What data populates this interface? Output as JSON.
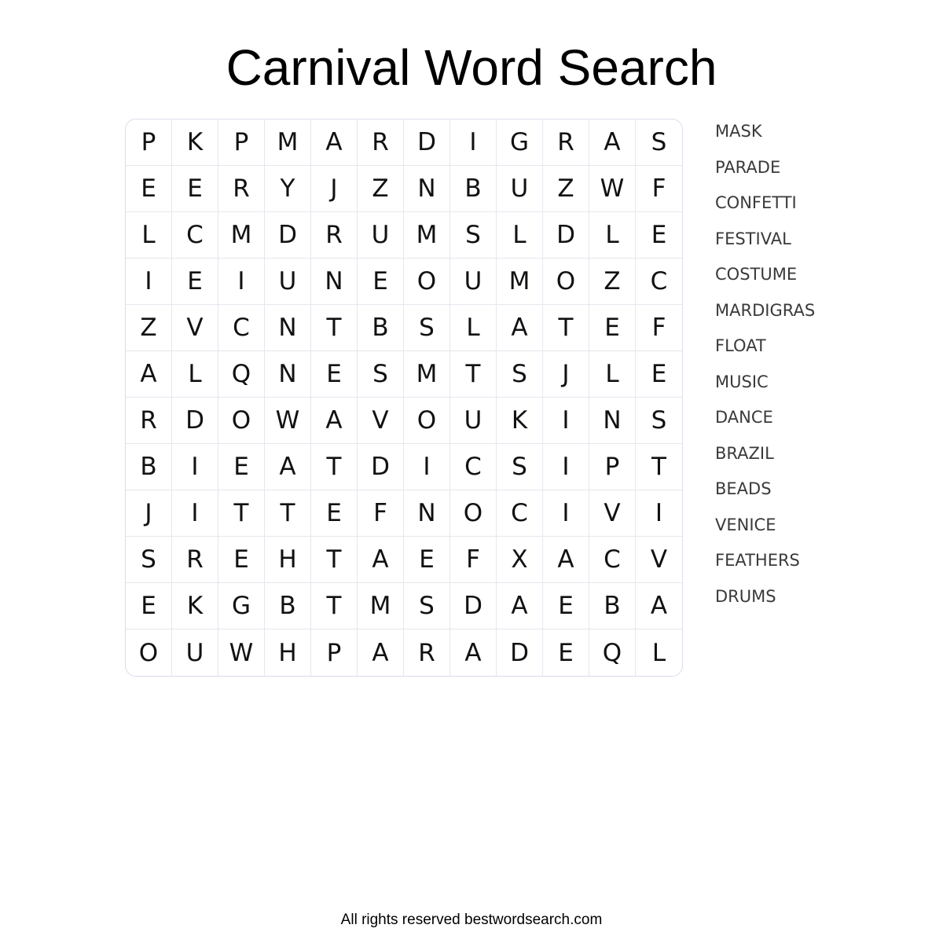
{
  "title": "Carnival Word Search",
  "grid": [
    [
      "P",
      "K",
      "P",
      "M",
      "A",
      "R",
      "D",
      "I",
      "G",
      "R",
      "A",
      "S"
    ],
    [
      "E",
      "E",
      "R",
      "Y",
      "J",
      "Z",
      "N",
      "B",
      "U",
      "Z",
      "W",
      "F"
    ],
    [
      "L",
      "C",
      "M",
      "D",
      "R",
      "U",
      "M",
      "S",
      "L",
      "D",
      "L",
      "E"
    ],
    [
      "I",
      "E",
      "I",
      "U",
      "N",
      "E",
      "O",
      "U",
      "M",
      "O",
      "Z",
      "C"
    ],
    [
      "Z",
      "V",
      "C",
      "N",
      "T",
      "B",
      "S",
      "L",
      "A",
      "T",
      "E",
      "F"
    ],
    [
      "A",
      "L",
      "Q",
      "N",
      "E",
      "S",
      "M",
      "T",
      "S",
      "J",
      "L",
      "E"
    ],
    [
      "R",
      "D",
      "O",
      "W",
      "A",
      "V",
      "O",
      "U",
      "K",
      "I",
      "N",
      "S"
    ],
    [
      "B",
      "I",
      "E",
      "A",
      "T",
      "D",
      "I",
      "C",
      "S",
      "I",
      "P",
      "T"
    ],
    [
      "J",
      "I",
      "T",
      "T",
      "E",
      "F",
      "N",
      "O",
      "C",
      "I",
      "V",
      "I"
    ],
    [
      "S",
      "R",
      "E",
      "H",
      "T",
      "A",
      "E",
      "F",
      "X",
      "A",
      "C",
      "V"
    ],
    [
      "E",
      "K",
      "G",
      "B",
      "T",
      "M",
      "S",
      "D",
      "A",
      "E",
      "B",
      "A"
    ],
    [
      "O",
      "U",
      "W",
      "H",
      "P",
      "A",
      "R",
      "A",
      "D",
      "E",
      "Q",
      "L"
    ]
  ],
  "words": [
    "MASK",
    "PARADE",
    "CONFETTI",
    "FESTIVAL",
    "COSTUME",
    "MARDIGRAS",
    "FLOAT",
    "MUSIC",
    "DANCE",
    "BRAZIL",
    "BEADS",
    "VENICE",
    "FEATHERS",
    "DRUMS"
  ],
  "footer": "All rights reserved bestwordsearch.com"
}
